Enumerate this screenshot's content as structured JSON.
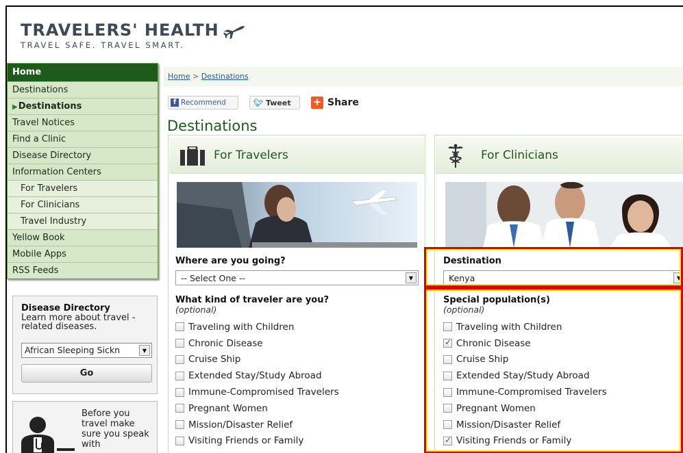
{
  "header": {
    "title": "TRAVELERS' HEALTH",
    "tagline": "TRAVEL SAFE. TRAVEL SMART.",
    "logo_icon": "airplane-icon"
  },
  "sidebar": {
    "home": "Home",
    "items": [
      {
        "label": "Destinations",
        "level": "top",
        "active": false
      },
      {
        "label": "Destinations",
        "level": "top",
        "active": true
      },
      {
        "label": "Travel Notices",
        "level": "top",
        "active": false
      },
      {
        "label": "Find a Clinic",
        "level": "top",
        "active": false
      },
      {
        "label": "Disease Directory",
        "level": "top",
        "active": false
      },
      {
        "label": "Information Centers",
        "level": "top",
        "active": false
      },
      {
        "label": "For Travelers",
        "level": "sub",
        "active": false
      },
      {
        "label": "For Clinicians",
        "level": "sub",
        "active": false
      },
      {
        "label": "Travel Industry",
        "level": "sub",
        "active": false
      },
      {
        "label": "Yellow Book",
        "level": "top",
        "active": false
      },
      {
        "label": "Mobile Apps",
        "level": "top",
        "active": false
      },
      {
        "label": "RSS Feeds",
        "level": "top",
        "active": false
      }
    ]
  },
  "disease_directory": {
    "title": "Disease Directory",
    "description": "Learn more about travel -related diseases.",
    "selected": "African Sleeping Sickn",
    "go_label": "Go"
  },
  "promo": {
    "text": "Before you travel make sure you speak with"
  },
  "breadcrumb": {
    "home": "Home",
    "separator": ">",
    "current": "Destinations"
  },
  "share": {
    "facebook": "Recommend",
    "twitter": "Tweet",
    "share": "Share"
  },
  "page_title": "Destinations",
  "travelers": {
    "heading": "For Travelers",
    "where_label": "Where are you going?",
    "where_value": "-- Select One --",
    "kind_label": "What kind of traveler are you?",
    "kind_optional": "(optional)",
    "options": [
      {
        "label": "Traveling with Children",
        "checked": false
      },
      {
        "label": "Chronic Disease",
        "checked": false
      },
      {
        "label": "Cruise Ship",
        "checked": false
      },
      {
        "label": "Extended Stay/Study Abroad",
        "checked": false
      },
      {
        "label": "Immune-Compromised Travelers",
        "checked": false
      },
      {
        "label": "Pregnant Women",
        "checked": false
      },
      {
        "label": "Mission/Disaster Relief",
        "checked": false
      },
      {
        "label": "Visiting Friends or Family",
        "checked": false
      }
    ]
  },
  "clinicians": {
    "heading": "For Clinicians",
    "destination_label": "Destination",
    "destination_value": "Kenya",
    "special_label": "Special population(s)",
    "special_optional": "(optional)",
    "options": [
      {
        "label": "Traveling with Children",
        "checked": false
      },
      {
        "label": "Chronic Disease",
        "checked": true
      },
      {
        "label": "Cruise Ship",
        "checked": false
      },
      {
        "label": "Extended Stay/Study Abroad",
        "checked": false
      },
      {
        "label": "Immune-Compromised Travelers",
        "checked": false
      },
      {
        "label": "Pregnant Women",
        "checked": false
      },
      {
        "label": "Mission/Disaster Relief",
        "checked": false
      },
      {
        "label": "Visiting Friends or Family",
        "checked": true
      }
    ]
  },
  "colors": {
    "brand_green": "#1e5a1a",
    "nav_bg": "#d6e8c8",
    "highlight_red": "#e00000",
    "highlight_yellow": "#ffe800",
    "link_blue": "#1f5aa8"
  }
}
